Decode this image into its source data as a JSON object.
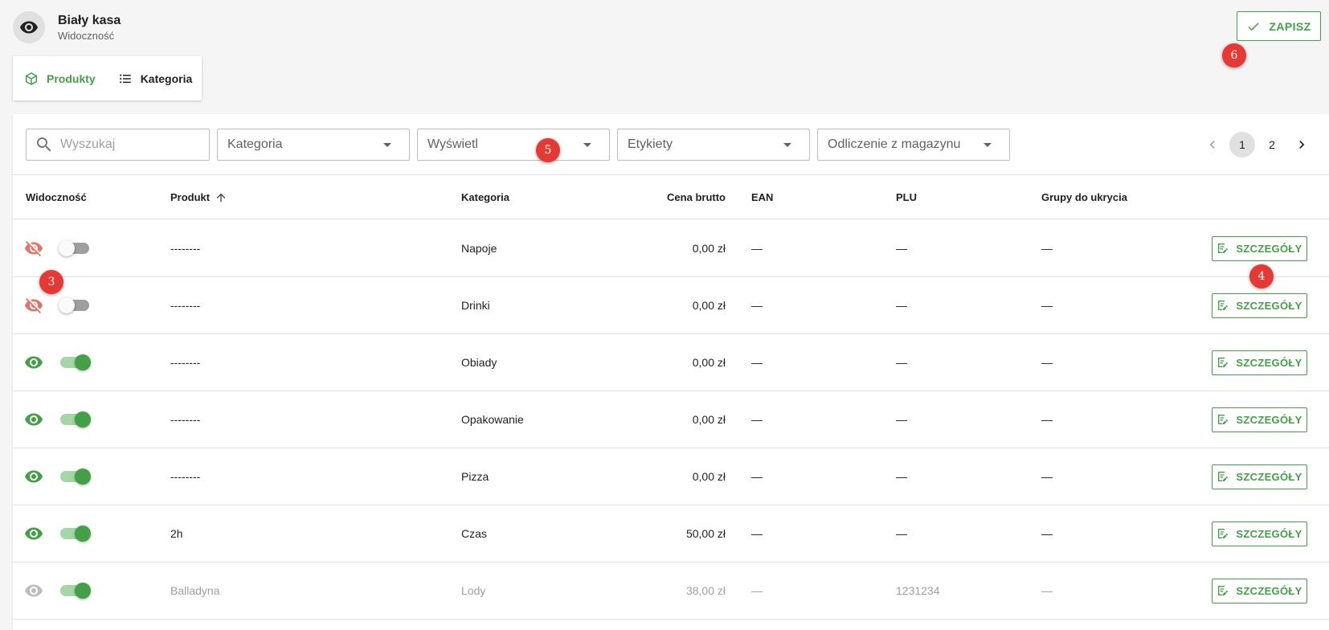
{
  "header": {
    "title": "Biały kasa",
    "subtitle": "Widoczność",
    "icon": "eye-icon"
  },
  "save_button": {
    "label": "ZAPISZ"
  },
  "tabs": [
    {
      "label": "Produkty",
      "icon": "cube-icon",
      "active": true
    },
    {
      "label": "Kategoria",
      "icon": "list-icon",
      "active": false
    }
  ],
  "filters": {
    "search_placeholder": "Wyszukaj",
    "selects": [
      "Kategoria",
      "Wyświetl",
      "Etykiety",
      "Odliczenie z magazynu"
    ]
  },
  "pagination": {
    "pages": [
      "1",
      "2"
    ],
    "current": "1"
  },
  "columns": {
    "visibility": "Widoczność",
    "product": "Produkt",
    "category": "Kategoria",
    "price": "Cena brutto",
    "ean": "EAN",
    "plu": "PLU",
    "groups": "Grupy do ukrycia"
  },
  "rows": [
    {
      "visible": false,
      "dimmed": false,
      "product": "--------",
      "category": "Napoje",
      "price": "0,00 zł",
      "ean": "—",
      "plu": "—",
      "groups": "—",
      "action": "SZCZEGÓŁY"
    },
    {
      "visible": false,
      "dimmed": false,
      "product": "--------",
      "category": "Drinki",
      "price": "0,00 zł",
      "ean": "—",
      "plu": "—",
      "groups": "—",
      "action": "SZCZEGÓŁY"
    },
    {
      "visible": true,
      "dimmed": false,
      "product": "--------",
      "category": "Obiady",
      "price": "0,00 zł",
      "ean": "—",
      "plu": "—",
      "groups": "—",
      "action": "SZCZEGÓŁY"
    },
    {
      "visible": true,
      "dimmed": false,
      "product": "--------",
      "category": "Opakowanie",
      "price": "0,00 zł",
      "ean": "—",
      "plu": "—",
      "groups": "—",
      "action": "SZCZEGÓŁY"
    },
    {
      "visible": true,
      "dimmed": false,
      "product": "--------",
      "category": "Pizza",
      "price": "0,00 zł",
      "ean": "—",
      "plu": "—",
      "groups": "—",
      "action": "SZCZEGÓŁY"
    },
    {
      "visible": true,
      "dimmed": false,
      "product": "2h",
      "category": "Czas",
      "price": "50,00 zł",
      "ean": "—",
      "plu": "—",
      "groups": "—",
      "action": "SZCZEGÓŁY"
    },
    {
      "visible": true,
      "dimmed": true,
      "product": "Balladyna",
      "category": "Lody",
      "price": "38,00 zł",
      "ean": "—",
      "plu": "1231234",
      "groups": "—",
      "action": "SZCZEGÓŁY"
    }
  ],
  "annotations": [
    "3",
    "4",
    "5",
    "6"
  ],
  "colors": {
    "accent": "#43a047",
    "hidden": "#e57361",
    "badge": "#e53935"
  }
}
